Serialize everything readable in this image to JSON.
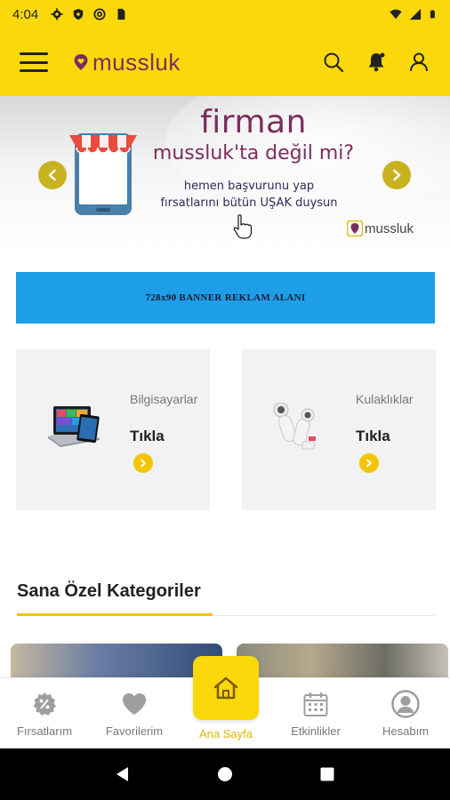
{
  "status_bar": {
    "time": "4:04",
    "left_icons": [
      "settings-icon",
      "shield-icon",
      "at-icon",
      "sim-icon"
    ],
    "right_icons": [
      "wifi-icon",
      "signal-icon",
      "battery-icon"
    ]
  },
  "app_bar": {
    "logo_text": "mussluk",
    "brand_color": "#7b2d5e",
    "background": "#fbd80c",
    "actions": [
      "search-icon",
      "bell-icon",
      "user-icon"
    ]
  },
  "hero": {
    "brand": "firman",
    "question": "mussluk'ta değil mi?",
    "line1": "hemen başvurunu yap",
    "line2": "fırsatlarını bütün UŞAK duysun",
    "logo_small": "mussluk"
  },
  "banner_ad": {
    "text": "728x90 BANNER REKLAM ALANI",
    "color": "#1e9ee9"
  },
  "categories": [
    {
      "name": "Bilgisayarlar",
      "cta": "Tıkla"
    },
    {
      "name": "Kulaklıklar",
      "cta": "Tıkla"
    }
  ],
  "section": {
    "title": "Sana Özel Kategoriler"
  },
  "bottom_nav": {
    "items": [
      {
        "label": "Fırsatlarım",
        "icon": "discount-icon"
      },
      {
        "label": "Favorilerim",
        "icon": "heart-icon"
      },
      {
        "label": "Ana Sayfa",
        "icon": "home-icon",
        "active": true
      },
      {
        "label": "Etkinlikler",
        "icon": "calendar-icon"
      },
      {
        "label": "Hesabım",
        "icon": "account-icon"
      }
    ],
    "active_color": "#e0b800"
  },
  "system_nav": [
    "back-icon",
    "home-circle-icon",
    "recents-icon"
  ]
}
